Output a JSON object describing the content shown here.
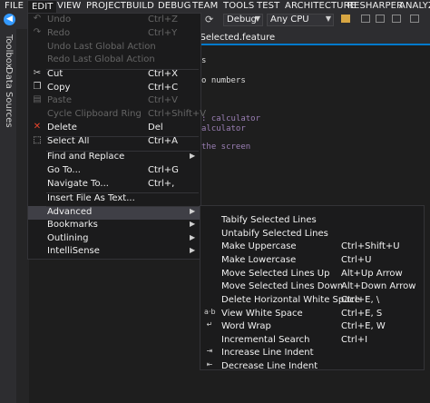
{
  "menubar": {
    "items": [
      "FILE",
      "EDIT",
      "VIEW",
      "PROJECT",
      "BUILD",
      "DEBUG",
      "TEAM",
      "TOOLS",
      "TEST",
      "ARCHITECTURE",
      "RESHARPER",
      "ANALYZE"
    ]
  },
  "toolbar": {
    "config_combo": "Debug",
    "platform_combo": "Any CPU"
  },
  "left_strip": {
    "toolbox": "Toolbox",
    "data_sources": "Data Sources"
  },
  "editor": {
    "doc_tab": "ToSelected.feature",
    "lines": [
      {
        "text": "s",
        "color": "#dcdcdc"
      },
      {
        "text": "o numbers",
        "color": "#dcdcdc"
      },
      {
        "text": ": calculator",
        "color": "#9b7fb5"
      },
      {
        "text": "alculator",
        "color": "#9b7fb5"
      },
      {
        "text": " the screen",
        "color": "#9b7fb5"
      }
    ]
  },
  "edit_menu": {
    "items": [
      {
        "icon": "undo-icon",
        "glyph": "↶",
        "label": "Undo",
        "shortcut": "Ctrl+Z",
        "enabled": false
      },
      {
        "icon": "redo-icon",
        "glyph": "↷",
        "label": "Redo",
        "shortcut": "Ctrl+Y",
        "enabled": false
      },
      {
        "icon": "",
        "glyph": "",
        "label": "Undo Last Global Action",
        "shortcut": "",
        "enabled": false
      },
      {
        "icon": "",
        "glyph": "",
        "label": "Redo Last Global Action",
        "shortcut": "",
        "enabled": false
      },
      {
        "icon": "cut-icon",
        "glyph": "✂",
        "label": "Cut",
        "shortcut": "Ctrl+X",
        "enabled": true
      },
      {
        "icon": "copy-icon",
        "glyph": "❐",
        "label": "Copy",
        "shortcut": "Ctrl+C",
        "enabled": true
      },
      {
        "icon": "paste-icon",
        "glyph": "▤",
        "label": "Paste",
        "shortcut": "Ctrl+V",
        "enabled": false
      },
      {
        "icon": "",
        "glyph": "",
        "label": "Cycle Clipboard Ring",
        "shortcut": "Ctrl+Shift+V",
        "enabled": false
      },
      {
        "icon": "delete-icon",
        "glyph": "✕",
        "label": "Delete",
        "shortcut": "Del",
        "enabled": true
      },
      {
        "icon": "select-all-icon",
        "glyph": "⬚",
        "label": "Select All",
        "shortcut": "Ctrl+A",
        "enabled": true
      },
      {
        "icon": "",
        "glyph": "",
        "label": "Find and Replace",
        "shortcut": "",
        "enabled": true,
        "submenu": true
      },
      {
        "icon": "",
        "glyph": "",
        "label": "Go To...",
        "shortcut": "Ctrl+G",
        "enabled": true
      },
      {
        "icon": "",
        "glyph": "",
        "label": "Navigate To...",
        "shortcut": "Ctrl+,",
        "enabled": true
      },
      {
        "icon": "",
        "glyph": "",
        "label": "Insert File As Text...",
        "shortcut": "",
        "enabled": true
      },
      {
        "icon": "",
        "glyph": "",
        "label": "Advanced",
        "shortcut": "",
        "enabled": true,
        "submenu": true,
        "highlight": true
      },
      {
        "icon": "",
        "glyph": "",
        "label": "Bookmarks",
        "shortcut": "",
        "enabled": true,
        "submenu": true
      },
      {
        "icon": "",
        "glyph": "",
        "label": "Outlining",
        "shortcut": "",
        "enabled": true,
        "submenu": true
      },
      {
        "icon": "",
        "glyph": "",
        "label": "IntelliSense",
        "shortcut": "",
        "enabled": true,
        "submenu": true
      }
    ]
  },
  "advanced_menu": {
    "items": [
      {
        "icon": "",
        "glyph": "",
        "label": "Tabify Selected Lines",
        "shortcut": ""
      },
      {
        "icon": "",
        "glyph": "",
        "label": "Untabify Selected Lines",
        "shortcut": ""
      },
      {
        "icon": "",
        "glyph": "",
        "label": "Make Uppercase",
        "shortcut": "Ctrl+Shift+U"
      },
      {
        "icon": "",
        "glyph": "",
        "label": "Make Lowercase",
        "shortcut": "Ctrl+U"
      },
      {
        "icon": "",
        "glyph": "",
        "label": "Move Selected Lines Up",
        "shortcut": "Alt+Up Arrow"
      },
      {
        "icon": "",
        "glyph": "",
        "label": "Move Selected Lines Down",
        "shortcut": "Alt+Down Arrow"
      },
      {
        "icon": "",
        "glyph": "",
        "label": "Delete Horizontal White Space",
        "shortcut": "Ctrl+E, \\"
      },
      {
        "icon": "view-white-space-icon",
        "glyph": "a·b",
        "label": "View White Space",
        "shortcut": "Ctrl+E, S"
      },
      {
        "icon": "word-wrap-icon",
        "glyph": "↵",
        "label": "Word Wrap",
        "shortcut": "Ctrl+E, W"
      },
      {
        "icon": "",
        "glyph": "",
        "label": "Incremental Search",
        "shortcut": "Ctrl+I"
      },
      {
        "icon": "increase-indent-icon",
        "glyph": "⇥",
        "label": "Increase Line Indent",
        "shortcut": ""
      },
      {
        "icon": "decrease-indent-icon",
        "glyph": "⇤",
        "label": "Decrease Line Indent",
        "shortcut": ""
      }
    ]
  },
  "colors": {
    "delete_icon": "#e8452c",
    "disabled_text": "#656565",
    "highlight": "#3f3f46"
  }
}
